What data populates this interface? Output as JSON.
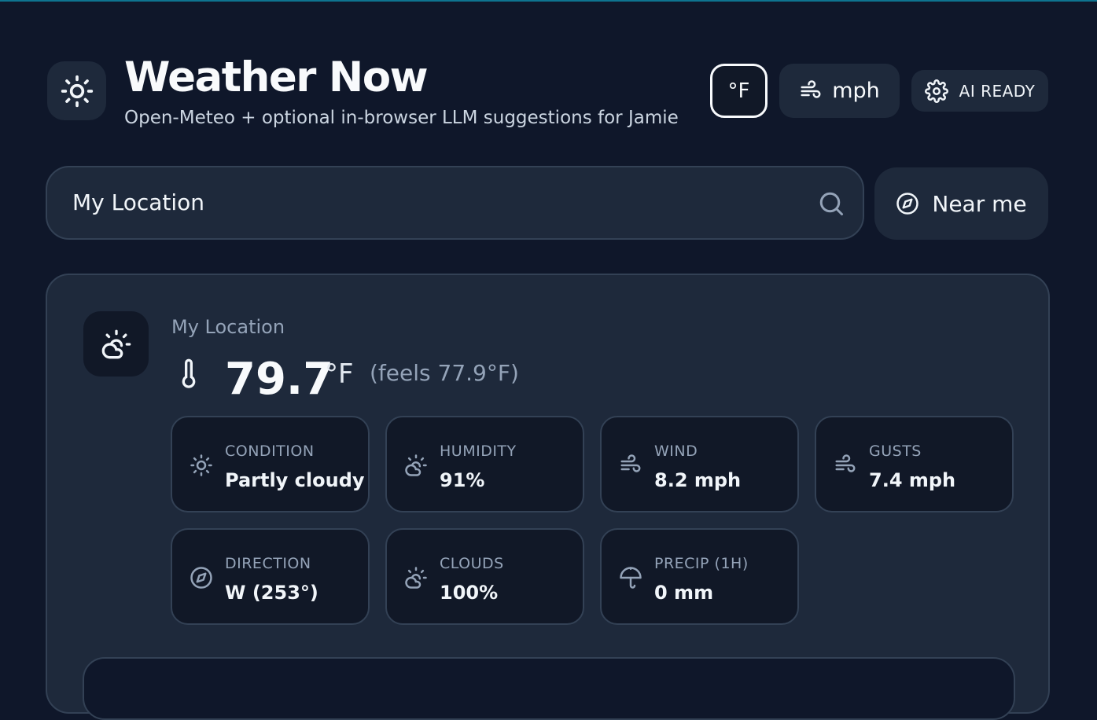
{
  "header": {
    "title": "Weather Now",
    "subtitle": "Open-Meteo + optional in-browser LLM suggestions for Jamie",
    "logo_icon": "sun-icon",
    "temp_unit_label": "°F",
    "wind_unit_label": "mph",
    "ai_status_label": "AI READY"
  },
  "search": {
    "value": "My Location",
    "near_me_label": "Near me"
  },
  "current": {
    "location": "My Location",
    "temperature": "79.7",
    "unit": "°F",
    "feels_like": "(feels 77.9°F)",
    "condition_icon": "partly-cloudy-icon"
  },
  "metrics": [
    {
      "label": "CONDITION",
      "value": "Partly cloudy",
      "icon": "sun-icon"
    },
    {
      "label": "HUMIDITY",
      "value": "91%",
      "icon": "partly-cloudy-icon"
    },
    {
      "label": "WIND",
      "value": "8.2 mph",
      "icon": "wind-icon"
    },
    {
      "label": "GUSTS",
      "value": "7.4 mph",
      "icon": "wind-icon"
    },
    {
      "label": "DIRECTION",
      "value": "W (253°)",
      "icon": "compass-icon"
    },
    {
      "label": "CLOUDS",
      "value": "100%",
      "icon": "partly-cloudy-icon"
    },
    {
      "label": "PRECIP (1H)",
      "value": "0 mm",
      "icon": "umbrella-icon"
    }
  ],
  "colors": {
    "background": "#0f172a",
    "surface": "#1e293b",
    "tile": "#111827",
    "border": "#334155",
    "muted_text": "#94a3b8",
    "accent_line": "#0e7490"
  }
}
